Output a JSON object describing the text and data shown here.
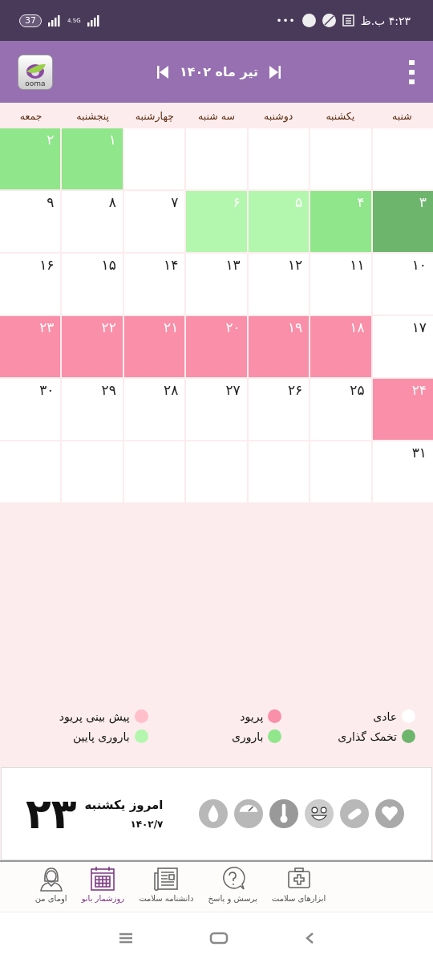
{
  "status_bar": {
    "time": "۴:۲۳ ب.ظ",
    "battery": "37",
    "network": "4.5G",
    "more": "•••"
  },
  "header": {
    "logo": "ooma",
    "title": "تیر ماه ۱۴۰۲"
  },
  "weekdays": [
    "شنبه",
    "یکشنبه",
    "دوشنبه",
    "سه شنبه",
    "چهارشنبه",
    "پنجشنبه",
    "جمعه"
  ],
  "weeks": [
    [
      {
        "kind": "blank"
      },
      {
        "kind": "blank"
      },
      {
        "kind": "blank"
      },
      {
        "kind": "blank"
      },
      {
        "kind": "blank"
      },
      {
        "kind": "fertile",
        "day": "۱"
      },
      {
        "kind": "fertile",
        "day": "۲"
      }
    ],
    [
      {
        "kind": "ovulation",
        "day": "۳"
      },
      {
        "kind": "fertile",
        "day": "۴"
      },
      {
        "kind": "low_fertile",
        "day": "۵"
      },
      {
        "kind": "low_fertile",
        "day": "۶"
      },
      {
        "kind": "normal",
        "day": "۷"
      },
      {
        "kind": "normal",
        "day": "۸"
      },
      {
        "kind": "normal",
        "day": "۹"
      }
    ],
    [
      {
        "kind": "normal",
        "day": "۱۰"
      },
      {
        "kind": "normal",
        "day": "۱۱"
      },
      {
        "kind": "normal",
        "day": "۱۲"
      },
      {
        "kind": "normal",
        "day": "۱۳"
      },
      {
        "kind": "normal",
        "day": "۱۴"
      },
      {
        "kind": "normal",
        "day": "۱۵"
      },
      {
        "kind": "normal",
        "day": "۱۶"
      }
    ],
    [
      {
        "kind": "normal",
        "day": "۱۷"
      },
      {
        "kind": "period",
        "day": "۱۸"
      },
      {
        "kind": "period",
        "day": "۱۹"
      },
      {
        "kind": "period",
        "day": "۲۰"
      },
      {
        "kind": "period",
        "day": "۲۱"
      },
      {
        "kind": "period",
        "day": "۲۲"
      },
      {
        "kind": "period",
        "day": "۲۳"
      }
    ],
    [
      {
        "kind": "period",
        "day": "۲۴"
      },
      {
        "kind": "normal",
        "day": "۲۵"
      },
      {
        "kind": "normal",
        "day": "۲۶"
      },
      {
        "kind": "normal",
        "day": "۲۷"
      },
      {
        "kind": "normal",
        "day": "۲۸"
      },
      {
        "kind": "normal",
        "day": "۲۹"
      },
      {
        "kind": "normal",
        "day": "۳۰"
      }
    ],
    [
      {
        "kind": "normal",
        "day": "۳۱"
      },
      {
        "kind": "blank"
      },
      {
        "kind": "blank"
      },
      {
        "kind": "blank"
      },
      {
        "kind": "blank"
      },
      {
        "kind": "blank"
      },
      {
        "kind": "blank"
      }
    ]
  ],
  "legend": [
    {
      "label": "عادی",
      "color": "#ffffff"
    },
    {
      "label": "پریود",
      "color": "#f98fa8"
    },
    {
      "label": "پیش بینی پریود",
      "color": "#ffc0cb"
    },
    {
      "label": "تخمک گذاری",
      "color": "#6db56d"
    },
    {
      "label": "باروری",
      "color": "#90e68a"
    },
    {
      "label": "باروری پایین",
      "color": "#b3f7ae"
    }
  ],
  "today": {
    "day": "۲۳",
    "label": "امروز یکشنبه",
    "date": "۱۴۰۲/۷"
  },
  "nav": [
    {
      "label": "ابزارهای سلامت",
      "selected": false
    },
    {
      "label": "پرسش و پاسخ",
      "selected": false
    },
    {
      "label": "دانشنامه سلامت",
      "selected": false
    },
    {
      "label": "روزشمار بانو",
      "selected": true
    },
    {
      "label": "اومای من",
      "selected": false
    }
  ]
}
